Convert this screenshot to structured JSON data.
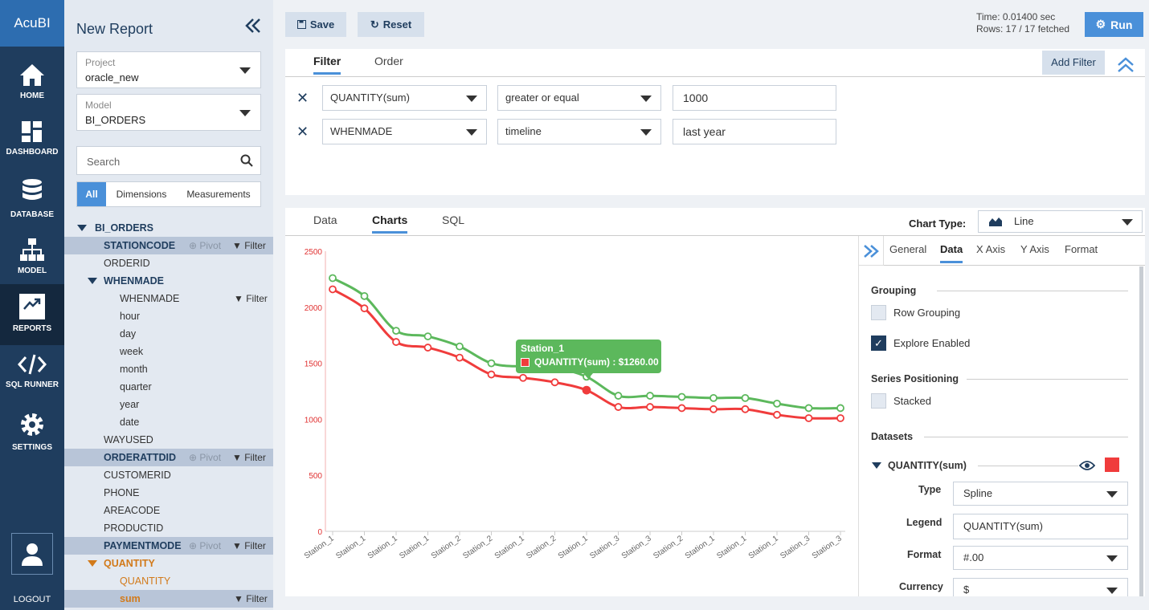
{
  "app": {
    "logo": "AcuBI"
  },
  "nav": [
    {
      "label": "HOME",
      "icon": "home-icon"
    },
    {
      "label": "DASHBOARD",
      "icon": "dashboard-icon"
    },
    {
      "label": "DATABASE",
      "icon": "database-icon"
    },
    {
      "label": "MODEL",
      "icon": "model-icon"
    },
    {
      "label": "REPORTS",
      "icon": "reports-icon"
    },
    {
      "label": "SQL RUNNER",
      "icon": "code-icon"
    },
    {
      "label": "SETTINGS",
      "icon": "gear-icon"
    }
  ],
  "logout": "LOGOUT",
  "sidebar": {
    "title": "New Report",
    "project": {
      "label": "Project",
      "value": "oracle_new"
    },
    "model": {
      "label": "Model",
      "value": "BI_ORDERS"
    },
    "search_placeholder": "Search",
    "segments": [
      "All",
      "Dimensions",
      "Measurements"
    ],
    "pivot": "Pivot",
    "filter": "Filter",
    "tree": [
      "BI_ORDERS",
      "STATIONCODE",
      "ORDERID",
      "WHENMADE",
      "WHENMADE",
      "hour",
      "day",
      "week",
      "month",
      "quarter",
      "year",
      "date",
      "WAYUSED",
      "ORDERATTDID",
      "CUSTOMERID",
      "PHONE",
      "AREACODE",
      "PRODUCTID",
      "PAYMENTMODE",
      "QUANTITY",
      "QUANTITY",
      "sum"
    ]
  },
  "toolbar": {
    "save": "Save",
    "reset": "Reset",
    "run": "Run"
  },
  "stats": {
    "time": "Time: 0.01400 sec",
    "rows": "Rows: 17 / 17 fetched"
  },
  "filter_panel": {
    "tabs": [
      "Filter",
      "Order"
    ],
    "add_filter": "Add Filter",
    "rows": [
      {
        "field": "QUANTITY(sum)",
        "op": "greater or equal",
        "value": "1000"
      },
      {
        "field": "WHENMADE",
        "op": "timeline",
        "value": "last year"
      }
    ]
  },
  "results": {
    "tabs": [
      "Data",
      "Charts",
      "SQL"
    ],
    "chart_type_label": "Chart Type:",
    "chart_type": "Line"
  },
  "settings": {
    "tabs": [
      "General",
      "Data",
      "X Axis",
      "Y Axis",
      "Format"
    ],
    "grouping": "Grouping",
    "row_grouping": "Row Grouping",
    "explore_enabled": "Explore Enabled",
    "series_positioning": "Series Positioning",
    "stacked": "Stacked",
    "datasets": "Datasets",
    "dataset_name": "QUANTITY(sum)",
    "type_label": "Type",
    "type_value": "Spline",
    "legend_label": "Legend",
    "legend_value": "QUANTITY(sum)",
    "format_label": "Format",
    "format_value": "#.00",
    "currency_label": "Currency",
    "currency_value": "$",
    "colors": {
      "dataset": "#f03c3c",
      "accent": "#4a90d9",
      "nav": "#1f3d5e"
    }
  },
  "tooltip": {
    "title": "Station_1",
    "text": "QUANTITY(sum) : $1260.00"
  },
  "chart_data": {
    "type": "line",
    "categories": [
      "Station_1",
      "Station_1",
      "Station_1",
      "Station_1",
      "Station_2",
      "Station_2",
      "Station_1",
      "Station_2",
      "Station_1",
      "Station_3",
      "Station_3",
      "Station_2",
      "Station_1",
      "Station_1",
      "Station_1",
      "Station_3",
      "Station_3"
    ],
    "series": [
      {
        "name": "QUANTITY(sum)",
        "color": "#f03c3c",
        "values": [
          2160,
          1990,
          1690,
          1640,
          1550,
          1400,
          1370,
          1330,
          1260,
          1110,
          1110,
          1100,
          1090,
          1090,
          1040,
          1010,
          1010
        ]
      },
      {
        "color": "#5cb85c",
        "values": [
          2260,
          2100,
          1790,
          1740,
          1650,
          1500,
          1470,
          1460,
          1380,
          1210,
          1210,
          1200,
          1190,
          1190,
          1140,
          1100,
          1100
        ]
      }
    ],
    "yticks": [
      0,
      500,
      1000,
      1500,
      2000,
      2500
    ],
    "ylim": [
      0,
      2500
    ],
    "grid": false
  }
}
